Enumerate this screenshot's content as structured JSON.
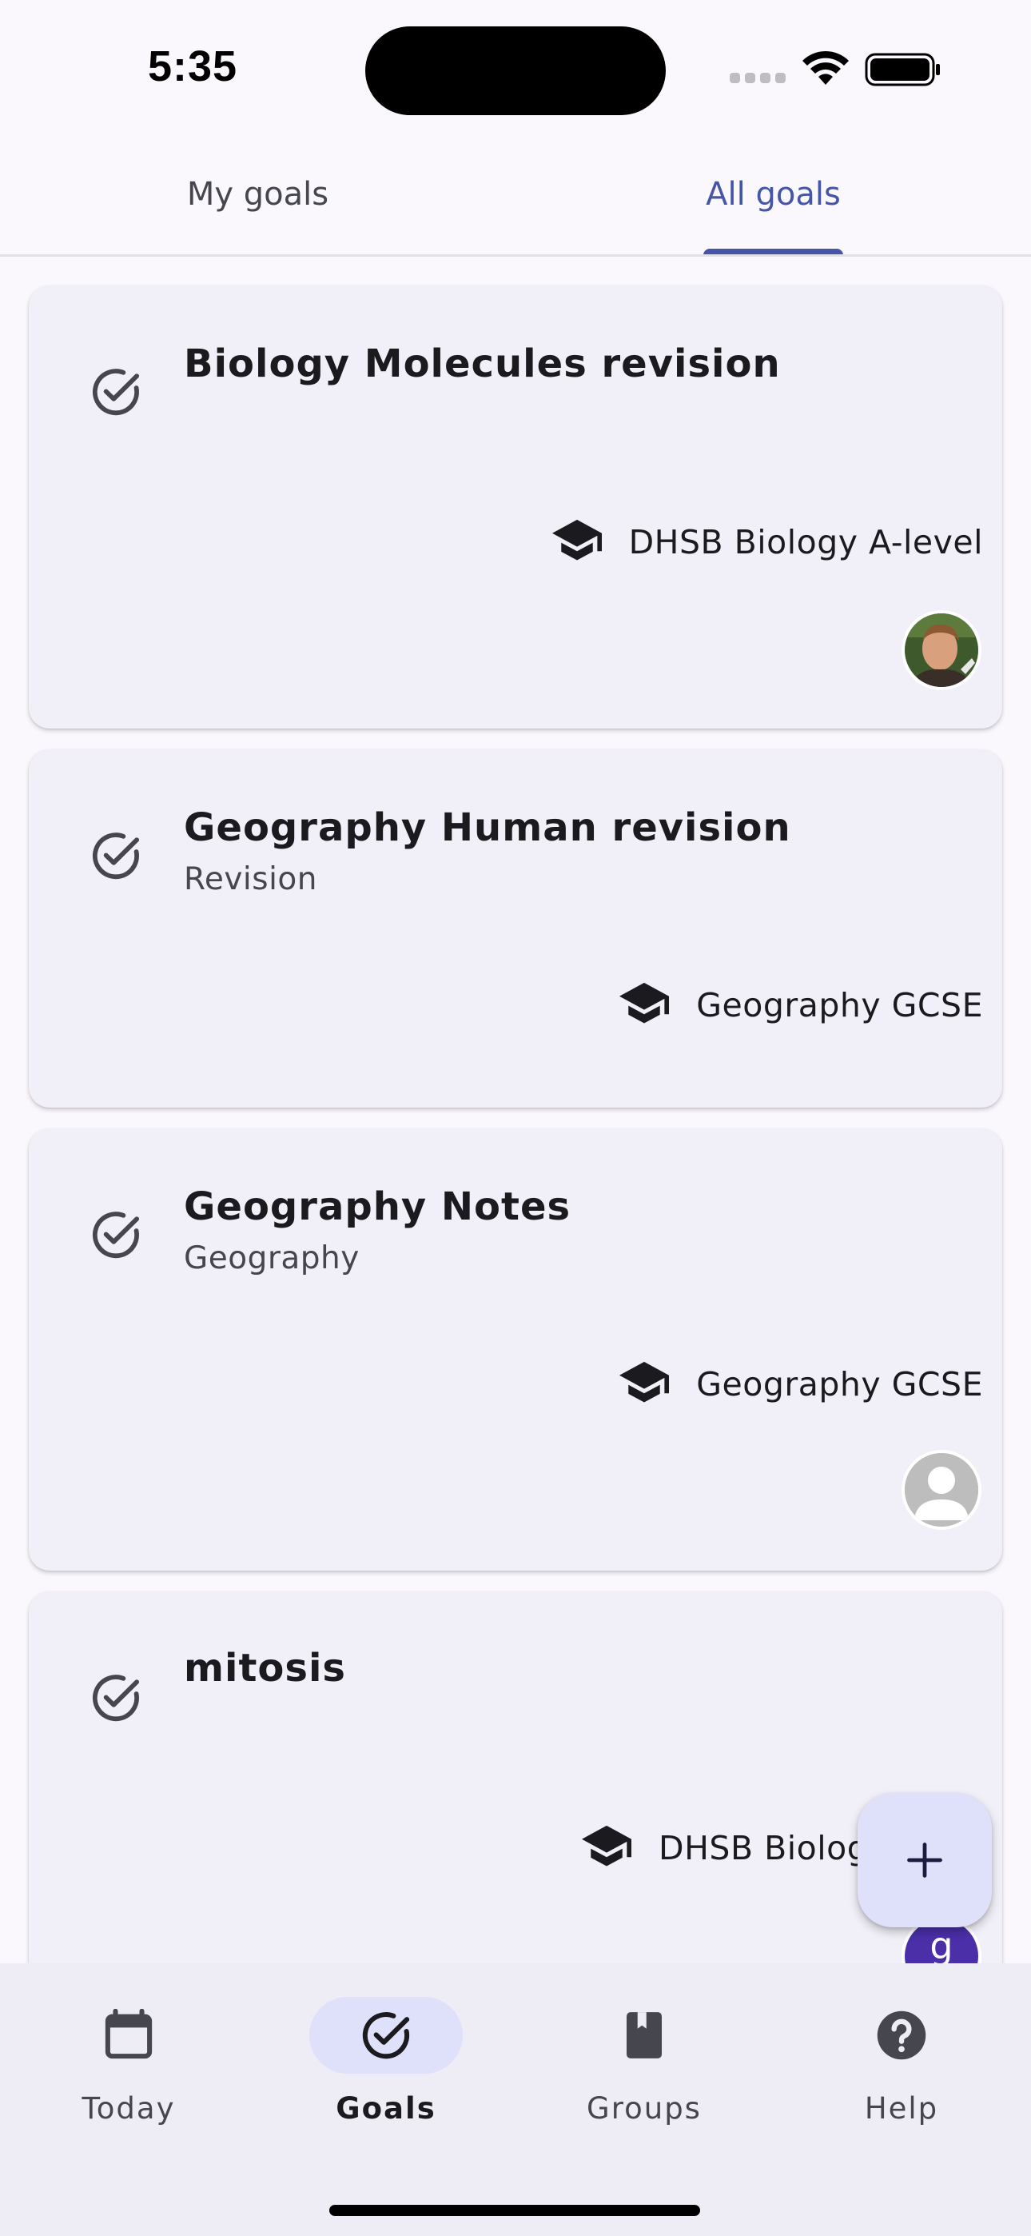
{
  "status_bar": {
    "time": "5:35"
  },
  "tabs": [
    {
      "label": "My goals",
      "active": false
    },
    {
      "label": "All goals",
      "active": true
    }
  ],
  "goals": [
    {
      "title": "Biology Molecules revision",
      "subtitle": "",
      "group": "DHSB Biology A-level",
      "avatar": "photo"
    },
    {
      "title": "Geography Human revision",
      "subtitle": "Revision",
      "group": "Geography GCSE",
      "avatar": ""
    },
    {
      "title": "Geography Notes",
      "subtitle": "Geography",
      "group": "Geography GCSE",
      "avatar": "placeholder"
    },
    {
      "title": "mitosis",
      "subtitle": "",
      "group": "DHSB Biology",
      "avatar": "initial",
      "avatar_initial": "g"
    }
  ],
  "fab": {
    "icon": "plus-icon"
  },
  "bottom_nav": [
    {
      "label": "Today",
      "icon": "calendar-icon",
      "active": false
    },
    {
      "label": "Goals",
      "icon": "check-circle-icon",
      "active": true
    },
    {
      "label": "Groups",
      "icon": "book-icon",
      "active": false
    },
    {
      "label": "Help",
      "icon": "help-icon",
      "active": false
    }
  ],
  "colors": {
    "accent": "#4556A6",
    "background": "#FBF8FD",
    "card": "#F1EFF7",
    "nav_background": "#EEEDF6",
    "selected_pill": "#DFE0F9",
    "avatar_initial_bg": "#4A2FA8"
  }
}
